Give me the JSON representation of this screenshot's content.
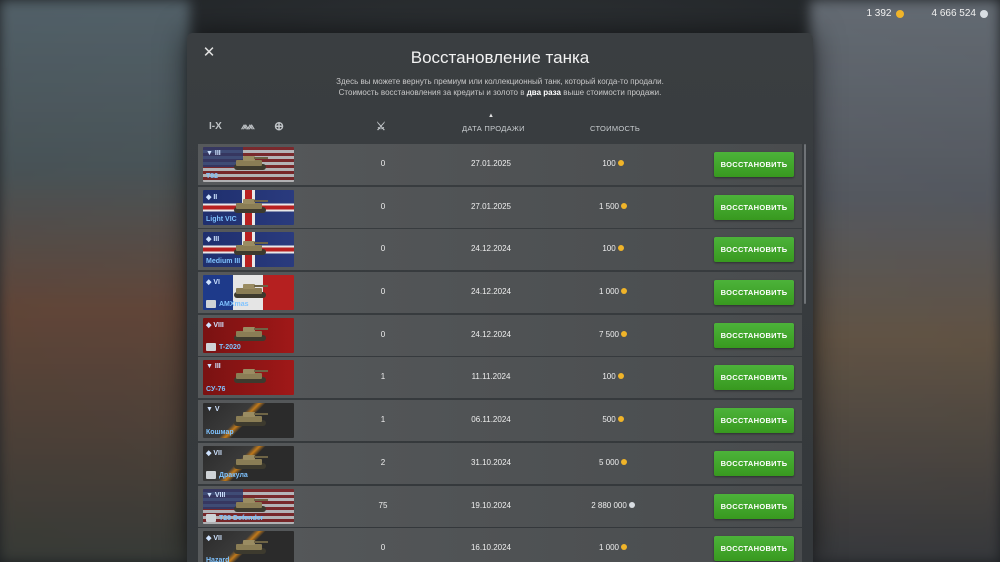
{
  "currency": {
    "gold": "1 392",
    "silver": "4 666 524"
  },
  "dialog": {
    "title": "Восстановление танка",
    "description_line1": "Здесь вы можете вернуть премиум или коллекционный танк, который когда-то продали.",
    "description_line2_pre": "Стоимость восстановления за кредиты и золото в ",
    "description_line2_bold": "два раза",
    "description_line2_post": " выше стоимости продажи.",
    "close_icon": "close-icon"
  },
  "toolbar": {
    "filters": [
      {
        "icon": "tier-filter-icon",
        "label": "I-X"
      },
      {
        "icon": "type-filter-icon",
        "label": "⩕⩕"
      },
      {
        "icon": "nation-filter-icon",
        "label": "⊕"
      }
    ],
    "battles_icon": "crossed-swords-icon",
    "col_date": "ДАТА ПРОДАЖИ",
    "col_cost": "СТОИМОСТЬ"
  },
  "rows": [
    {
      "tier": "▼ III",
      "name": "T82",
      "flag": "usa",
      "badge": false,
      "battles": "0",
      "date": "27.01.2025",
      "cost": "100",
      "currency": "gold",
      "button": "ВОССТАНОВИТЬ"
    },
    {
      "tier": "◆ II",
      "name": "Light VIC",
      "flag": "uk",
      "badge": false,
      "battles": "0",
      "date": "27.01.2025",
      "cost": "1 500",
      "currency": "gold",
      "button": "ВОССТАНОВИТЬ"
    },
    {
      "tier": "◆ III",
      "name": "Medium III",
      "flag": "uk",
      "badge": false,
      "battles": "0",
      "date": "24.12.2024",
      "cost": "100",
      "currency": "gold",
      "button": "ВОССТАНОВИТЬ"
    },
    {
      "tier": "◆ VI",
      "name": "AMXmas",
      "flag": "france",
      "badge": true,
      "battles": "0",
      "date": "24.12.2024",
      "cost": "1 000",
      "currency": "gold",
      "button": "ВОССТАНОВИТЬ"
    },
    {
      "tier": "◆ VIII",
      "name": "T-2020",
      "flag": "ussr",
      "badge": true,
      "battles": "0",
      "date": "24.12.2024",
      "cost": "7 500",
      "currency": "gold",
      "button": "ВОССТАНОВИТЬ"
    },
    {
      "tier": "▼ III",
      "name": "СУ-76",
      "flag": "ussr",
      "badge": false,
      "battles": "1",
      "date": "11.11.2024",
      "cost": "100",
      "currency": "gold",
      "button": "ВОССТАНОВИТЬ"
    },
    {
      "tier": "▼ V",
      "name": "Кошмар",
      "flag": "halloween",
      "badge": false,
      "battles": "1",
      "date": "06.11.2024",
      "cost": "500",
      "currency": "gold",
      "button": "ВОССТАНОВИТЬ"
    },
    {
      "tier": "◆ VII",
      "name": "Дракула",
      "flag": "halloween",
      "badge": true,
      "battles": "2",
      "date": "31.10.2024",
      "cost": "5 000",
      "currency": "gold",
      "button": "ВОССТАНОВИТЬ"
    },
    {
      "tier": "▼ VIII",
      "name": "T28 Defender",
      "flag": "usa",
      "badge": true,
      "battles": "75",
      "date": "19.10.2024",
      "cost": "2 880 000",
      "currency": "silver",
      "button": "ВОССТАНОВИТЬ"
    },
    {
      "tier": "◆ VII",
      "name": "Hazard",
      "flag": "halloween",
      "badge": false,
      "battles": "0",
      "date": "16.10.2024",
      "cost": "1 000",
      "currency": "gold",
      "button": "ВОССТАНОВИТЬ"
    }
  ],
  "colors": {
    "button_green": "#3fa52b",
    "tier_blue": "#7fc3ff",
    "gold": "#f0b429"
  }
}
